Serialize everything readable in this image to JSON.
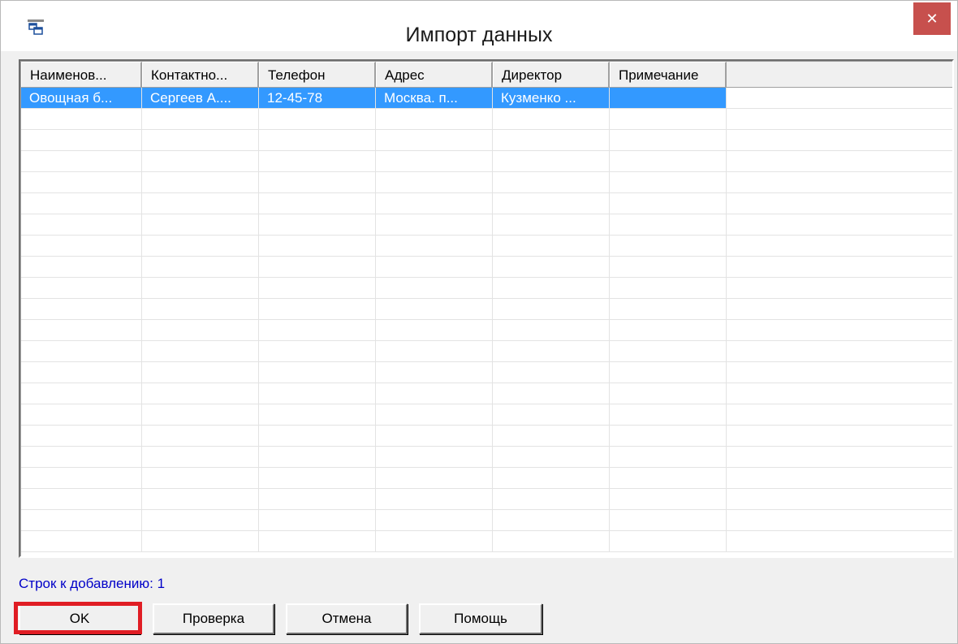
{
  "window": {
    "title": "Импорт данных",
    "close_glyph": "✕",
    "app_icon": "table-window-icon",
    "close_icon": "close-icon",
    "close_color": "#c7504d"
  },
  "grid": {
    "columns": [
      "Наименов...",
      "Контактно...",
      "Телефон",
      "Адрес",
      "Директор",
      "Примечание"
    ],
    "rows": [
      [
        "Овощная б...",
        "Сергеев А....",
        "12-45-78",
        "Москва. п...",
        "Кузменко ...",
        ""
      ]
    ],
    "empty_row_count": 21,
    "selected_row_color": "#3399ff"
  },
  "status": {
    "text": "Строк к добавлению: 1",
    "color": "#0000c8"
  },
  "buttons": {
    "ok": "OK",
    "check": "Проверка",
    "cancel": "Отмена",
    "help": "Помощь"
  },
  "highlight_color": "#e01d24"
}
